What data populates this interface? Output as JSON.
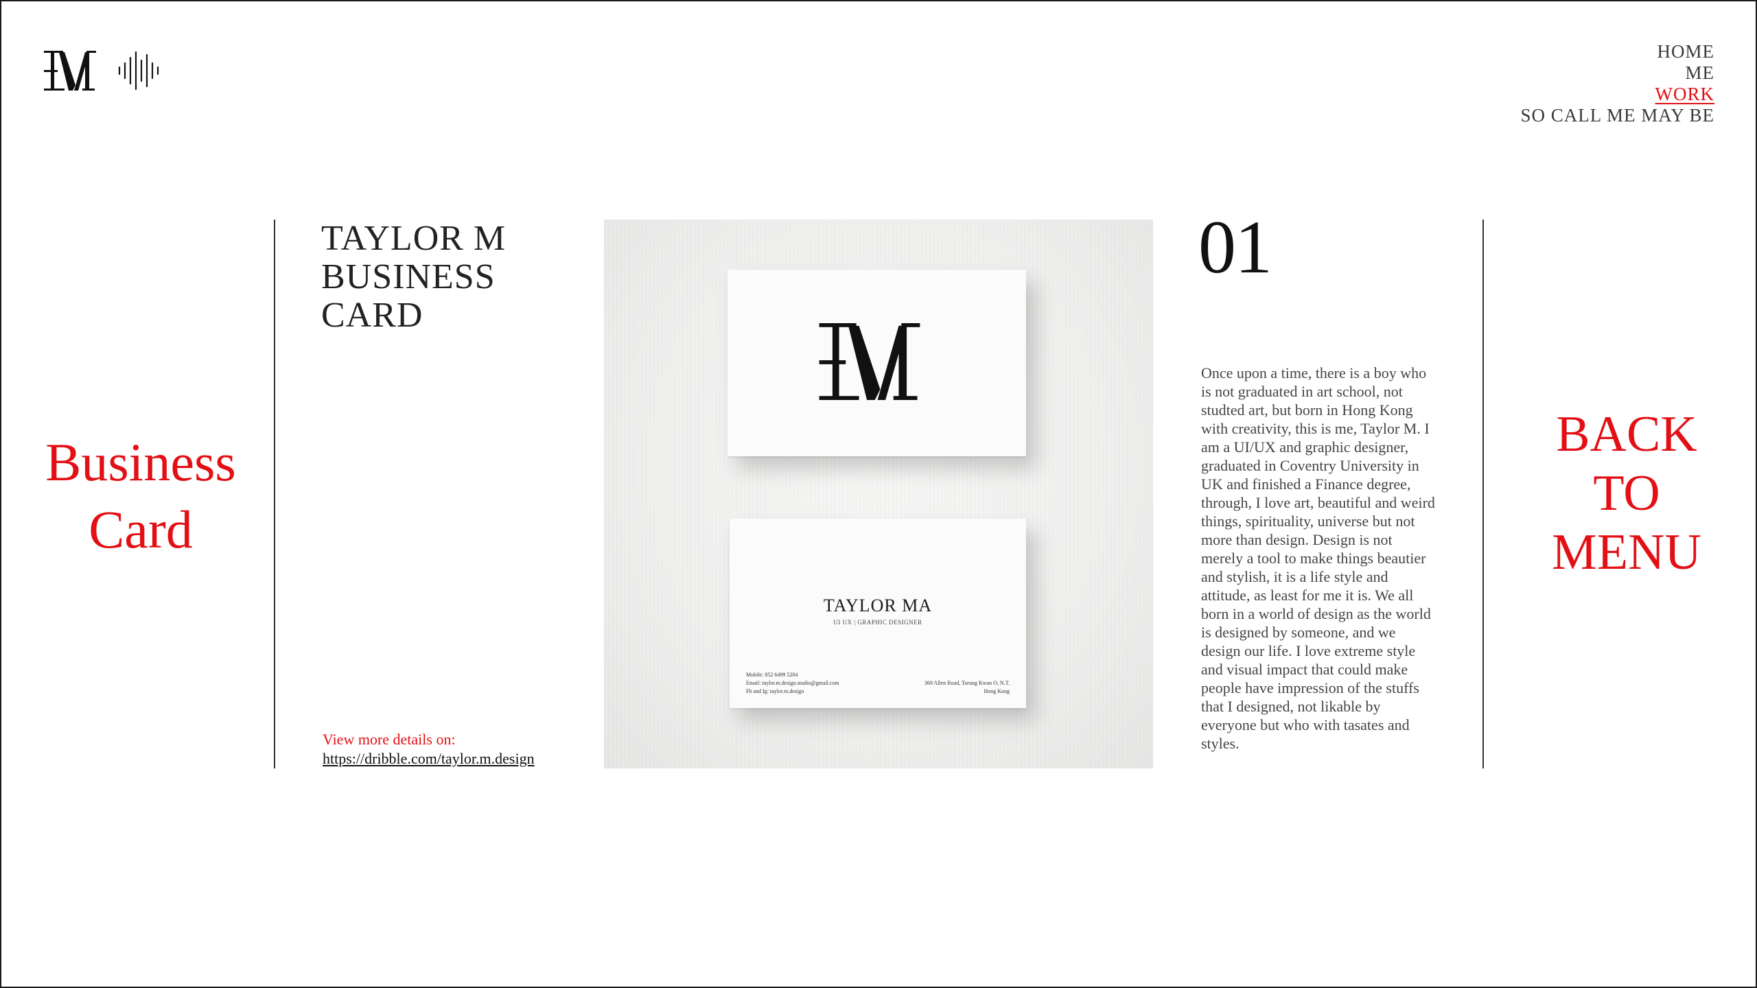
{
  "header": {
    "logo_icon": "tm-monogram-logo",
    "sound_icon": "sound-wave-icon",
    "nav": [
      {
        "label": "HOME",
        "active": false
      },
      {
        "label": "ME",
        "active": false
      },
      {
        "label": "WORK",
        "active": true
      },
      {
        "label": "SO CALL ME MAY BE",
        "active": false
      }
    ]
  },
  "section": {
    "title_line1": "Business",
    "title_line2": "Card"
  },
  "project": {
    "title_line1": "TAYLOR M",
    "title_line2": "BUSINESS",
    "title_line3": "CARD",
    "details_label": "View more details on:",
    "details_link": "https://dribble.com/taylor.m.design"
  },
  "mockup": {
    "card_name": "TAYLOR MA",
    "card_role": "UI UX | GRAPHIC DESIGNER",
    "card_contact_1": "Mobile: 852 6499 5204",
    "card_contact_2": "Email: taylor.m.design.studio@gmail.com",
    "card_contact_3": "Fb and Ig: taylor.m.design",
    "card_address_1": "369 Allen Road, Tseung Kwan O, N.T.",
    "card_address_2": "Hong Kong"
  },
  "number": "01",
  "description": "Once upon a time, there is a boy who is not graduated in art school, not studted art, but born in Hong Kong with creativity, this is me, Taylor M. I am a UI/UX and graphic designer, graduated in Coventry University in UK and finished a Finance degree, through, I love art, beautiful and weird things, spirituality, universe but not more than design. Design is not merely a tool to make things beautier and stylish, it is a life style and attitude, as least for me it is. We all born in a world of design as the world is designed by someone, and we design our life. I love extreme style and visual impact that could make people have impression of the stuffs that I designed, not likable by everyone but who with tasates and styles.",
  "back_menu": {
    "line1": "BACK",
    "line2": "TO",
    "line3": "MENU"
  },
  "colors": {
    "accent": "#e30f14",
    "text": "#111111",
    "body_text": "#444444"
  }
}
